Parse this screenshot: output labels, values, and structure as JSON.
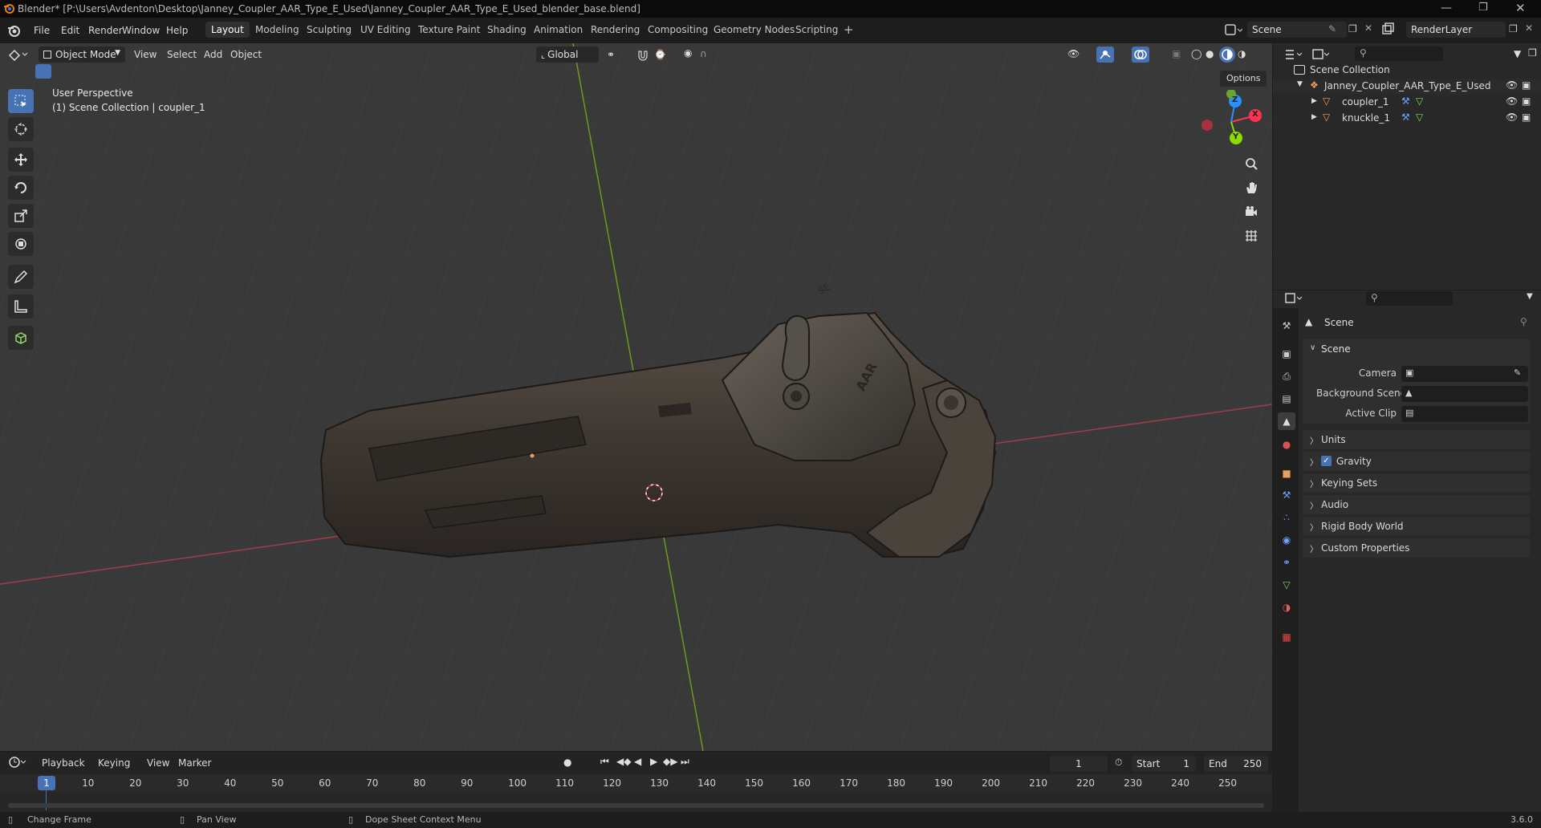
{
  "window": {
    "title": "Blender* [P:\\Users\\Avdenton\\Desktop\\Janney_Coupler_AAR_Type_E_Used\\Janney_Coupler_AAR_Type_E_Used_blender_base.blend]"
  },
  "menu": [
    "File",
    "Edit",
    "Render",
    "Window",
    "Help"
  ],
  "workspaces": [
    "Layout",
    "Modeling",
    "Sculpting",
    "UV Editing",
    "Texture Paint",
    "Shading",
    "Animation",
    "Rendering",
    "Compositing",
    "Geometry Nodes",
    "Scripting"
  ],
  "active_workspace": "Layout",
  "scene_selector": {
    "value": "Scene"
  },
  "render_layer": {
    "value": "RenderLayer"
  },
  "viewport": {
    "mode": "Object Mode",
    "menus": [
      "View",
      "Select",
      "Add",
      "Object"
    ],
    "orientation": "Global",
    "options_label": "Options",
    "overlay_line1": "User Perspective",
    "overlay_line2": "(1) Scene Collection | coupler_1",
    "gizmo_axes": {
      "x": "X",
      "y": "Y",
      "z": "Z"
    },
    "model_text": {
      "aar": "AAR",
      "stamp": "SE"
    }
  },
  "outliner": {
    "root": "Scene Collection",
    "collection": "Janney_Coupler_AAR_Type_E_Used",
    "objects": [
      "coupler_1",
      "knuckle_1"
    ]
  },
  "properties": {
    "context_title": "Scene",
    "section": "Scene",
    "rows": [
      {
        "label": "Camera"
      },
      {
        "label": "Background Scene"
      },
      {
        "label": "Active Clip"
      }
    ],
    "panels": [
      "Units",
      "Gravity",
      "Keying Sets",
      "Audio",
      "Rigid Body World",
      "Custom Properties"
    ],
    "gravity_checked": true
  },
  "timeline": {
    "menus": [
      "Playback",
      "Keying",
      "View",
      "Marker"
    ],
    "current_frame": "1",
    "start_label": "Start",
    "start": "1",
    "end_label": "End",
    "end": "250",
    "ticks": [
      "1",
      "10",
      "20",
      "30",
      "40",
      "50",
      "60",
      "70",
      "80",
      "90",
      "100",
      "110",
      "120",
      "130",
      "140",
      "150",
      "160",
      "170",
      "180",
      "190",
      "200",
      "210",
      "220",
      "230",
      "240",
      "250"
    ]
  },
  "statusbar": {
    "items": [
      "Change Frame",
      "Pan View",
      "Dope Sheet Context Menu"
    ],
    "version": "3.6.0"
  },
  "colors": {
    "accent": "#4772b3",
    "x_axis": "#ff3352",
    "y_axis": "#8bdc00",
    "z_axis": "#2890ff",
    "object_orange": "#e8a15a"
  }
}
